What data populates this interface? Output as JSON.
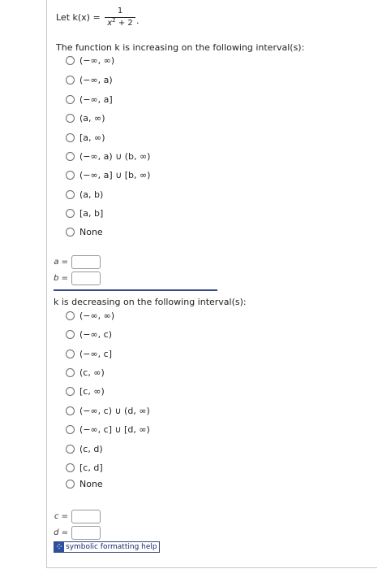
{
  "definition": {
    "prefix": "Let k(x) =",
    "numerator": "1",
    "denominator_base": "x",
    "denominator_exp": "2",
    "denominator_rest": " + 2",
    "suffix": "."
  },
  "increasing": {
    "question": "The function k is increasing on the following interval(s):",
    "options": [
      "(−∞, ∞)",
      "(−∞, a)",
      "(−∞, a]",
      "(a, ∞)",
      "[a, ∞)",
      "(−∞, a) ∪ (b, ∞)",
      "(−∞, a] ∪ [b, ∞)",
      "(a, b)",
      "[a, b]",
      "None"
    ],
    "vars": [
      {
        "label": "a =",
        "value": ""
      },
      {
        "label": "b =",
        "value": ""
      }
    ]
  },
  "decreasing": {
    "question": "k is decreasing on the following interval(s):",
    "options": [
      "(−∞, ∞)",
      "(−∞, c)",
      "(−∞, c]",
      "(c, ∞)",
      "[c, ∞)",
      "(−∞, c) ∪ (d, ∞)",
      "(−∞, c] ∪ [d, ∞)",
      "(c, d)",
      "[c, d]",
      "None"
    ],
    "vars": [
      {
        "label": "c =",
        "value": ""
      },
      {
        "label": "d =",
        "value": ""
      }
    ]
  },
  "help": {
    "icon": "grid-icon",
    "label": "symbolic formatting help"
  },
  "colors": {
    "divider": "#3c4a8c",
    "help_icon_bg": "#2c4f9e",
    "help_text": "#1a2a6c"
  }
}
